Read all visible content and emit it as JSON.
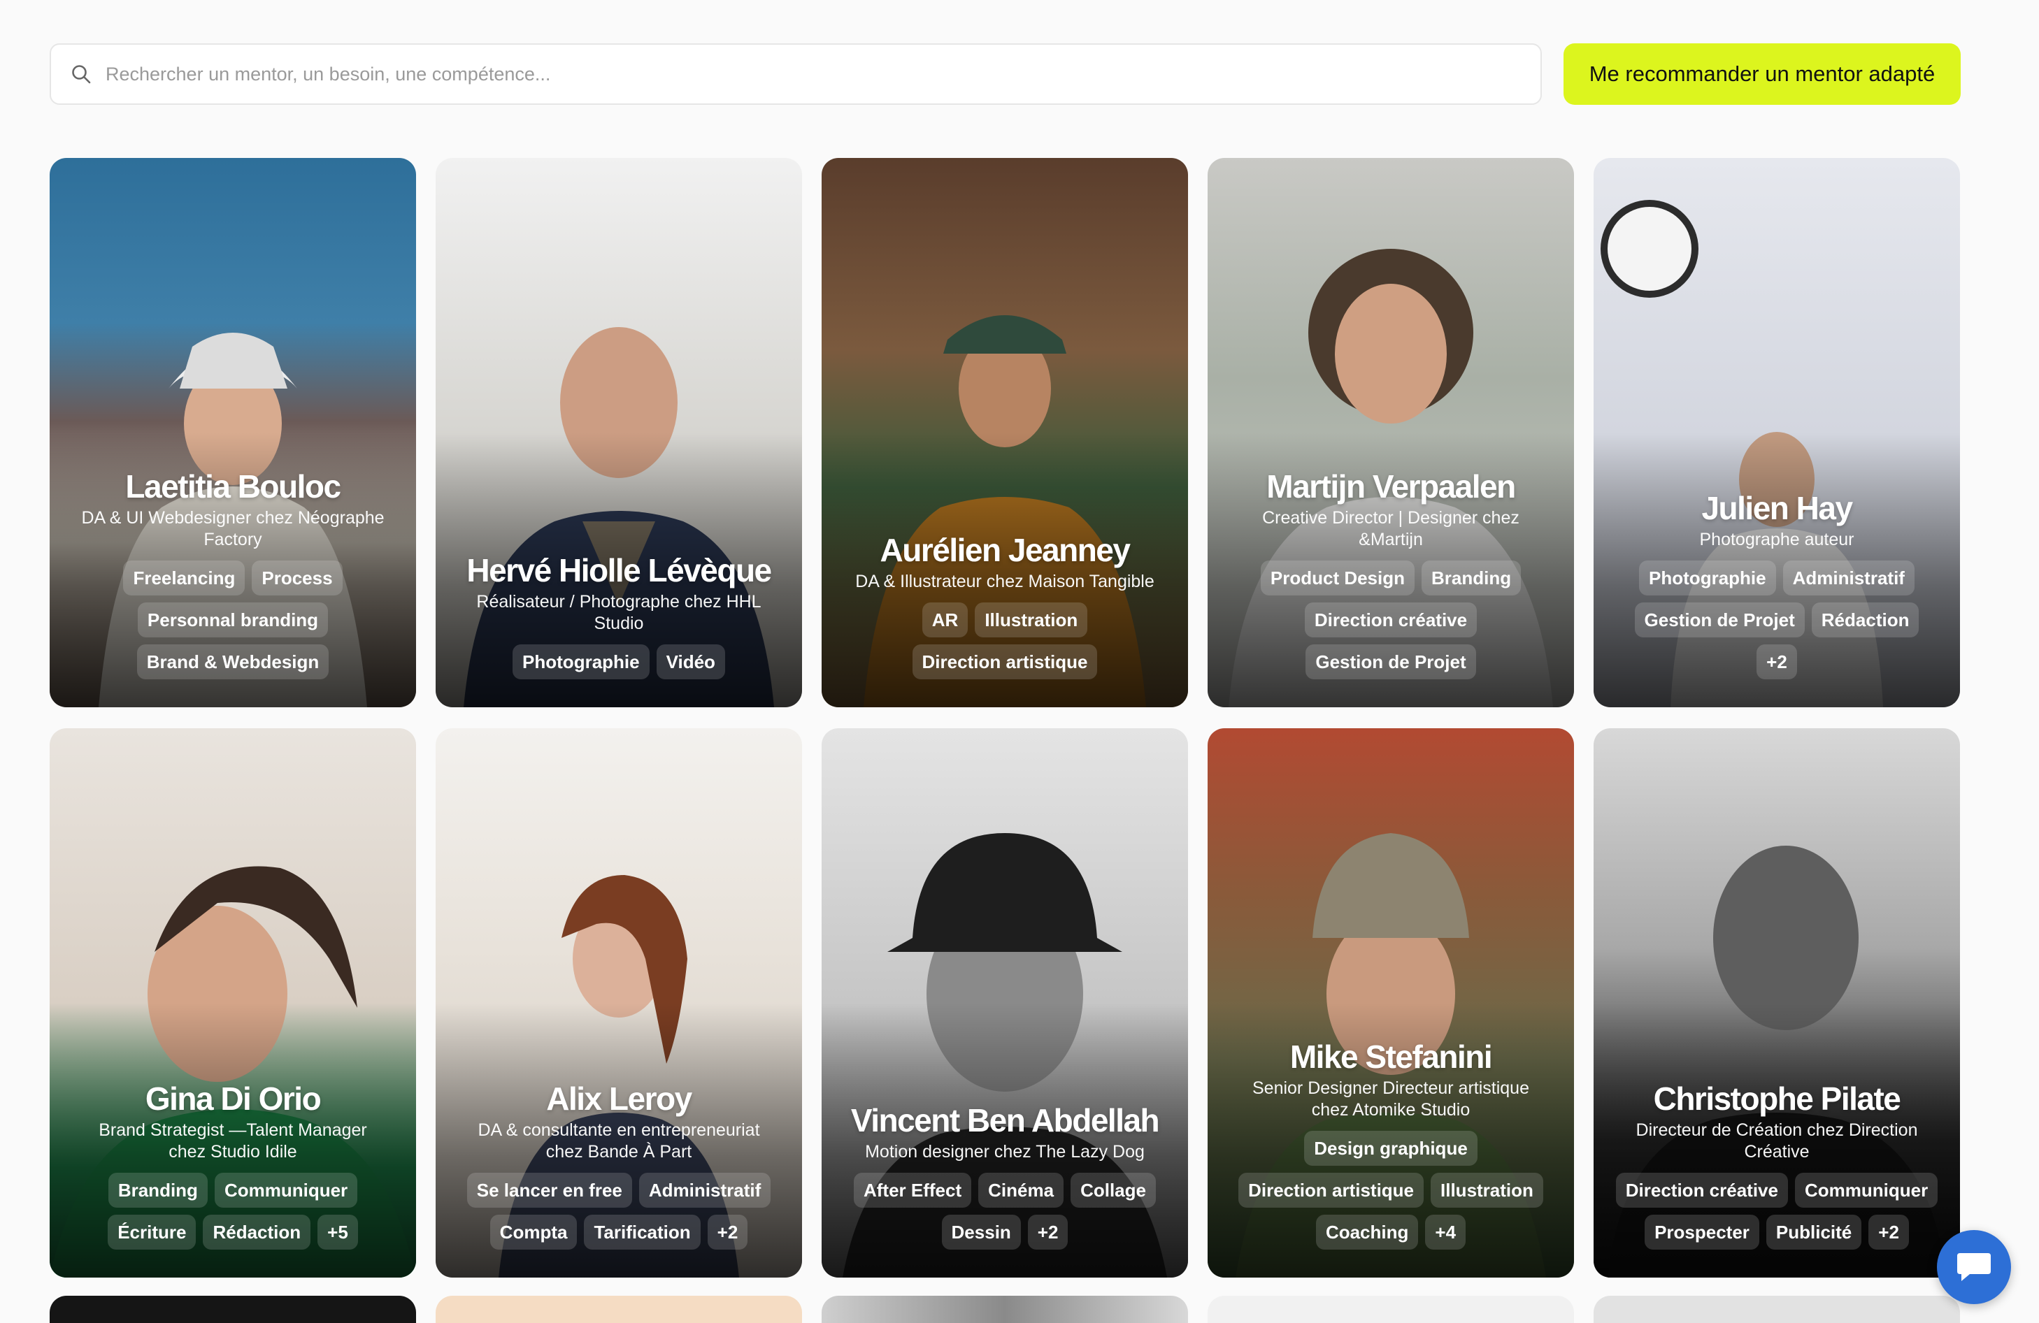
{
  "search": {
    "placeholder": "Rechercher un mentor, un besoin, une compétence...",
    "icon": "search-icon"
  },
  "cta_label": "Me recommander un mentor adapté",
  "colors": {
    "accent": "#dcf51e",
    "chat": "#2d6fd6"
  },
  "mentors": [
    {
      "name": "Laetitia Bouloc",
      "role": "DA & UI Webdesigner chez Néographe Factory",
      "tags": [
        "Freelancing",
        "Process",
        "Personnal branding",
        "Brand & Webdesign"
      ]
    },
    {
      "name": "Hervé Hiolle Lévèque",
      "role": "Réalisateur / Photographe chez HHL Studio",
      "tags": [
        "Photographie",
        "Vidéo"
      ]
    },
    {
      "name": "Aurélien Jeanney",
      "role": "DA & Illustrateur chez Maison Tangible",
      "tags": [
        "AR",
        "Illustration",
        "Direction artistique"
      ]
    },
    {
      "name": "Martijn Verpaalen",
      "role": "Creative Director | Designer chez &Martijn",
      "tags": [
        "Product Design",
        "Branding",
        "Direction créative",
        "Gestion de Projet"
      ]
    },
    {
      "name": "Julien Hay",
      "role": "Photographe auteur",
      "tags": [
        "Photographie",
        "Administratif",
        "Gestion de Projet",
        "Rédaction",
        "+2"
      ]
    },
    {
      "name": "Gina Di Orio",
      "role": "Brand Strategist —Talent Manager chez Studio Idile",
      "tags": [
        "Branding",
        "Communiquer",
        "Écriture",
        "Rédaction",
        "+5"
      ]
    },
    {
      "name": "Alix Leroy",
      "role": "DA & consultante en entrepreneuriat chez Bande À Part",
      "tags": [
        "Se lancer en free",
        "Administratif",
        "Compta",
        "Tarification",
        "+2"
      ]
    },
    {
      "name": "Vincent Ben Abdellah",
      "role": "Motion designer chez The Lazy Dog",
      "tags": [
        "After Effect",
        "Cinéma",
        "Collage",
        "Dessin",
        "+2"
      ]
    },
    {
      "name": "Mike Stefanini",
      "role": "Senior Designer Directeur artistique chez Atomike Studio",
      "tags": [
        "Design graphique",
        "Direction artistique",
        "Illustration",
        "Coaching",
        "+4"
      ]
    },
    {
      "name": "Christophe Pilate",
      "role": "Directeur de Création chez Direction Créative",
      "tags": [
        "Direction créative",
        "Communiquer",
        "Prospecter",
        "Publicité",
        "+2"
      ]
    }
  ],
  "chat_icon": "chat-icon"
}
